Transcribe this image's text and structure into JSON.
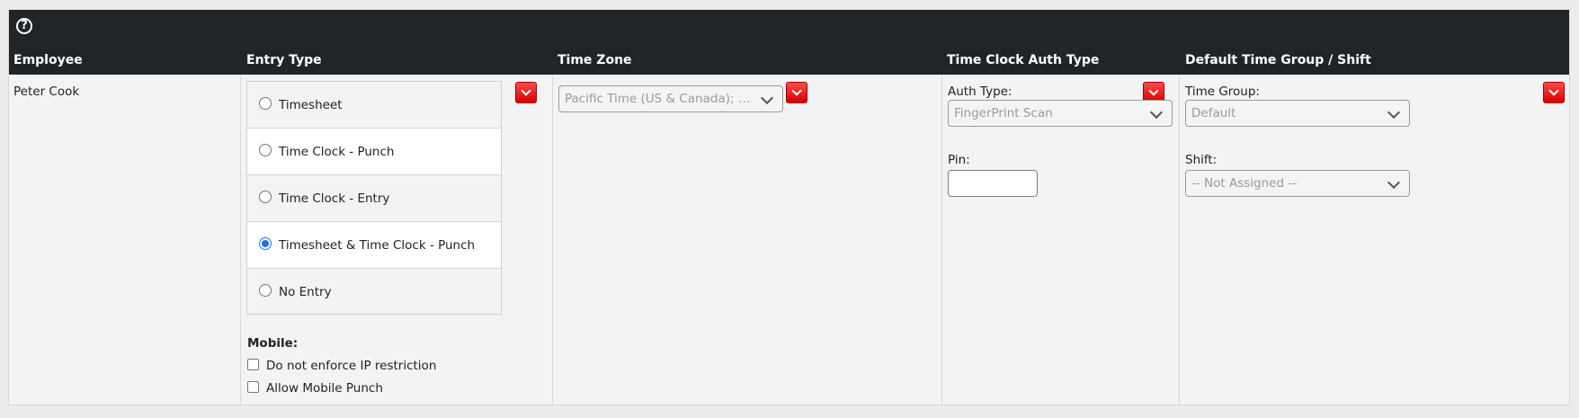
{
  "header": {
    "columns": {
      "employee": "Employee",
      "entry_type": "Entry Type",
      "time_zone": "Time Zone",
      "auth_type": "Time Clock Auth Type",
      "time_group": "Default Time Group / Shift"
    }
  },
  "employee": {
    "name": "Peter Cook"
  },
  "entry_type": {
    "options": [
      {
        "label": "Timesheet",
        "checked": false
      },
      {
        "label": "Time Clock - Punch",
        "checked": false
      },
      {
        "label": "Time Clock - Entry",
        "checked": false
      },
      {
        "label": "Timesheet & Time Clock - Punch",
        "checked": true
      },
      {
        "label": "No Entry",
        "checked": false
      }
    ],
    "mobile_label": "Mobile:",
    "mobile_options": [
      {
        "label": "Do not enforce IP restriction",
        "checked": false
      },
      {
        "label": "Allow Mobile Punch",
        "checked": false
      }
    ]
  },
  "time_zone": {
    "value": "Pacific Time (US & Canada); T..."
  },
  "auth": {
    "auth_type_label": "Auth Type:",
    "auth_type_value": "FingerPrint Scan",
    "pin_label": "Pin:",
    "pin_value": ""
  },
  "time_group": {
    "group_label": "Time Group:",
    "group_value": "Default",
    "shift_label": "Shift:",
    "shift_value": "-- Not Assigned --"
  },
  "icons": {
    "help": "help-circle-icon",
    "dropdown_button": "chevron-down-icon"
  },
  "colors": {
    "header_bg": "#212529",
    "button_red": "#e00000",
    "radio_selected": "#1a73e8"
  }
}
